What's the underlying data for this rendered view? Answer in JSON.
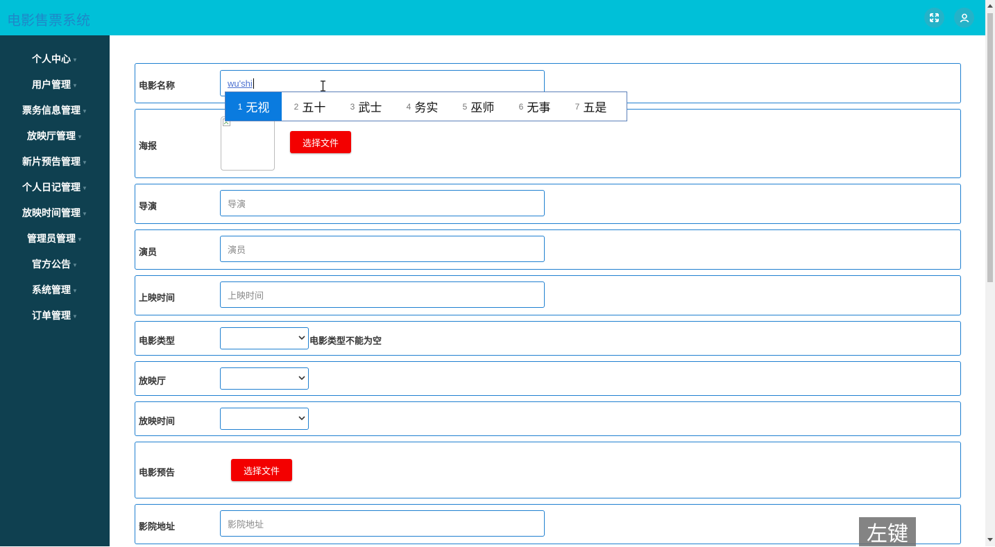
{
  "header": {
    "title": "电影售票系统",
    "fullscreen_icon": "expand-icon",
    "user_icon": "user-icon"
  },
  "sidebar": {
    "items": [
      {
        "label": "个人中心"
      },
      {
        "label": "用户管理"
      },
      {
        "label": "票务信息管理"
      },
      {
        "label": "放映厅管理"
      },
      {
        "label": "新片预告管理"
      },
      {
        "label": "个人日记管理"
      },
      {
        "label": "放映时间管理"
      },
      {
        "label": "管理员管理"
      },
      {
        "label": "官方公告"
      },
      {
        "label": "系统管理"
      },
      {
        "label": "订单管理"
      }
    ]
  },
  "form": {
    "movie_name": {
      "label": "电影名称",
      "value": "wu'shi"
    },
    "poster": {
      "label": "海报",
      "button": "选择文件"
    },
    "director": {
      "label": "导演",
      "placeholder": "导演"
    },
    "actors": {
      "label": "演员",
      "placeholder": "演员"
    },
    "release_time": {
      "label": "上映时间",
      "placeholder": "上映时间"
    },
    "movie_type": {
      "label": "电影类型",
      "value": "",
      "error": "电影类型不能为空"
    },
    "hall": {
      "label": "放映厅",
      "value": ""
    },
    "show_time": {
      "label": "放映时间",
      "value": ""
    },
    "trailer": {
      "label": "电影预告",
      "button": "选择文件"
    },
    "cinema_address": {
      "label": "影院地址",
      "placeholder": "影院地址"
    }
  },
  "ime": {
    "candidates": [
      {
        "num": "1",
        "text": "无视"
      },
      {
        "num": "2",
        "text": "五十"
      },
      {
        "num": "3",
        "text": "武士"
      },
      {
        "num": "4",
        "text": "务实"
      },
      {
        "num": "5",
        "text": "巫师"
      },
      {
        "num": "6",
        "text": "无事"
      },
      {
        "num": "7",
        "text": "五是"
      }
    ]
  },
  "overlay": {
    "mouse_hint": "左键"
  },
  "colors": {
    "header": "#00c0d8",
    "sidebar": "#0f4050",
    "accent": "#1e7fd0",
    "danger": "#f30000",
    "ime_selected": "#0a7bdf"
  }
}
